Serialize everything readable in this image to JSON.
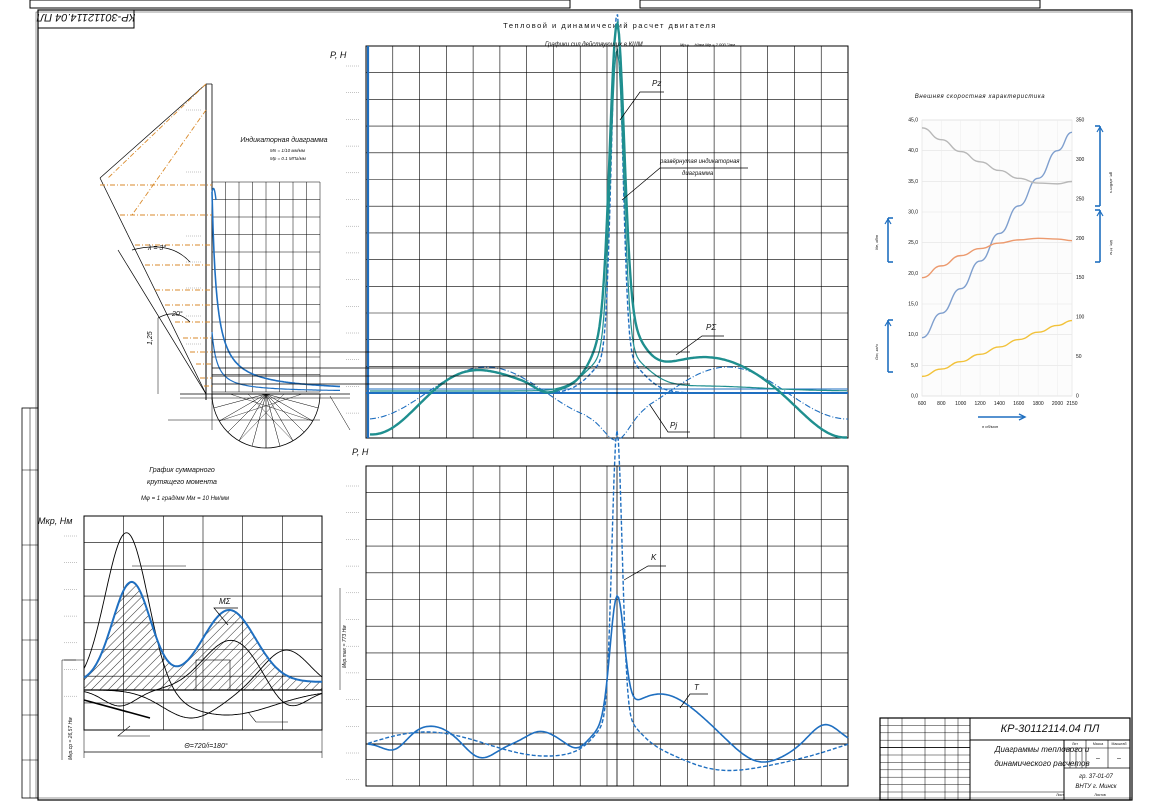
{
  "drawing": {
    "code": "КР-30112114.04 ПЛ",
    "code_rotated": "КР-30112114.04 ПЛ",
    "main_title": "Тепловой и динамический расчет двигателя",
    "colors": {
      "blue": "#1f6fc0",
      "teal": "#1f8f8f",
      "grid": "#000000",
      "orange": "#d98a2b",
      "yellow": "#f2c23a",
      "gray": "#b8b8b8",
      "steelblue": "#7f9fce",
      "salmon": "#ec9a6e"
    }
  },
  "indicator": {
    "title": "Индикаторная диаграмма",
    "sub1": "Mn = 1/10 мм/мм",
    "sub2": "Mp = 0.1 МПа/мм",
    "angle_label": "λ = 3°",
    "side_label": "1,25",
    "angle2": "20°"
  },
  "forces": {
    "title": "Графики сил действующих в КШМ",
    "title_sub": "Mp = ... Н/мм   Mφ = 2.000 °/мм",
    "ylabel": "P, Н",
    "label_pz": "Pz",
    "label_develop": "развёрнутая индикаторная",
    "label_develop2": "диаграмма",
    "label_psum": "PΣ",
    "label_pj": "Pj"
  },
  "tk": {
    "ylabel": "P, Н",
    "label_k": "K",
    "label_t": "T"
  },
  "torque": {
    "title1": "График суммарного",
    "title2": "крутящего момента",
    "scale": "Mφ = 1 град/мм   Mм = 10  Нм/мм",
    "ylabel": "Mкр, Нм",
    "label_m": "MΣ",
    "period": "Θ=720/i=180°",
    "mcp_label": "Mкр.ср = 26,57 Нм",
    "side_label": "Mкр.max = 773 Нм"
  },
  "chart_data": {
    "type": "line",
    "title": "Внешняя скоростная характеристика",
    "x": [
      600,
      800,
      1000,
      1200,
      1400,
      1600,
      1800,
      2000,
      2150
    ],
    "x_ticks": [
      "600",
      "800",
      "1000",
      "1200",
      "1400",
      "1600",
      "1800",
      "2000",
      "2150"
    ],
    "y_left_ticks": [
      "0,0",
      "5,0",
      "10,0",
      "15,0",
      "20,0",
      "25,0",
      "30,0",
      "35,0",
      "40,0",
      "45,0"
    ],
    "y_right_ticks": [
      "0",
      "50",
      "100",
      "150",
      "200",
      "250",
      "300",
      "350"
    ],
    "ylim_left": [
      0,
      45
    ],
    "ylim_right": [
      0,
      350
    ],
    "xlim": [
      600,
      2150
    ],
    "xlabel": "n об/мин",
    "ylabel_left": "Ne, кВт",
    "ylabel_left2": "Gт, кг/ч",
    "ylabel_right": "ge, г/кВт·ч",
    "ylabel_right2": "Me, Н·м",
    "series": [
      {
        "color": "#7f9fce",
        "axis": "left",
        "values": [
          9.5,
          13.5,
          17.5,
          22,
          26.5,
          31,
          35.5,
          40,
          43
        ]
      },
      {
        "color": "#b8b8b8",
        "axis": "right",
        "values": [
          340,
          325,
          310,
          297,
          286,
          276,
          270,
          269,
          272
        ]
      },
      {
        "color": "#ec9a6e",
        "axis": "right",
        "values": [
          150,
          165,
          178,
          187,
          194,
          198,
          200,
          199,
          197
        ]
      },
      {
        "color": "#f2c23a",
        "axis": "left",
        "values": [
          3.2,
          4.4,
          5.6,
          6.8,
          8,
          9.2,
          10.4,
          11.5,
          12.3
        ]
      }
    ],
    "grid": true
  },
  "title_block": {
    "code": "КР-30112114.04 ПЛ",
    "name1": "Диаграммы теплового и",
    "name2": "динамического расчетов",
    "org1": "гр. 37-01-07",
    "org2": "ВНТУ г. Минск",
    "lit": "Лит",
    "mass": "Масса",
    "scale": "Масштаб",
    "sheet": "Лист",
    "sheets": "Листов",
    "dash": "–"
  }
}
